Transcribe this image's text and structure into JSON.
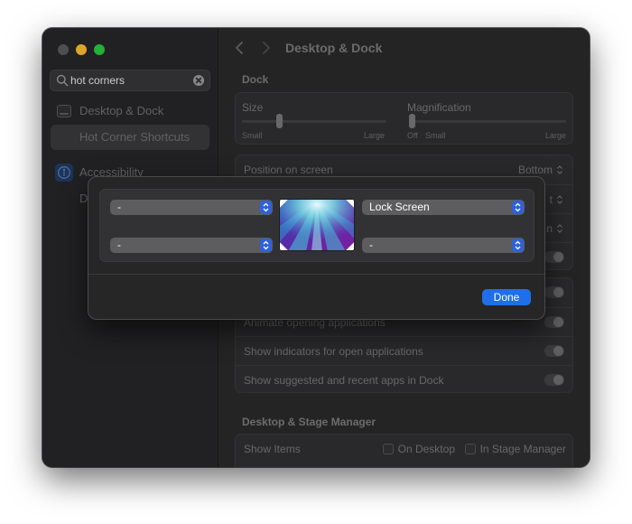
{
  "window": {
    "title": "Desktop & Dock"
  },
  "sidebar": {
    "search_value": "hot corners",
    "items": [
      {
        "label": "Desktop & Dock"
      },
      {
        "label": "Hot Corner Shortcuts"
      },
      {
        "label": "Accessibility"
      },
      {
        "label": "D"
      }
    ]
  },
  "dock": {
    "heading": "Dock",
    "size": {
      "label": "Size",
      "min_label": "Small",
      "max_label": "Large",
      "level": 0.25
    },
    "magnification": {
      "label": "Magnification",
      "off_label": "Off",
      "min_label": "Small",
      "max_label": "Large",
      "level": 0.0
    },
    "position": {
      "label": "Position on screen",
      "value": "Bottom"
    },
    "hidden_values": [
      "t",
      "n"
    ],
    "animate_label": "Animate opening applications",
    "indicators_label": "Show indicators for open applications",
    "suggested_label": "Show suggested and recent apps in Dock"
  },
  "desktop": {
    "heading": "Desktop & Stage Manager",
    "show_items_label": "Show Items",
    "on_desktop_label": "On Desktop",
    "in_stage_manager_label": "In Stage Manager"
  },
  "hot_corners": {
    "top_left": "-",
    "top_right": "Lock Screen",
    "bottom_left": "-",
    "bottom_right": "-",
    "done_label": "Done"
  },
  "colors": {
    "accent": "#1f6fe6",
    "window_bg": "#2c2c2e"
  }
}
